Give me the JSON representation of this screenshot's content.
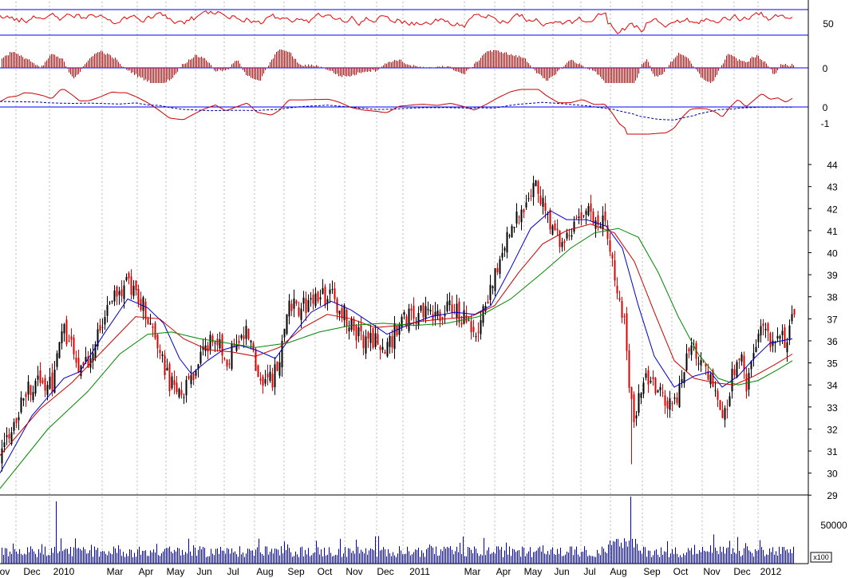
{
  "chart_data": {
    "type": "candlestick",
    "price_axis": {
      "ticks": [
        29,
        30,
        31,
        32,
        33,
        34,
        35,
        36,
        37,
        38,
        39,
        40,
        41,
        42,
        43,
        44
      ],
      "ylim": [
        28.5,
        44.8
      ]
    },
    "x_labels": [
      "ov",
      "Dec",
      "2010",
      "Mar",
      "Apr",
      "May",
      "Jun",
      "Jul",
      "Aug",
      "Sep",
      "Oct",
      "Nov",
      "Dec",
      "2011",
      "Mar",
      "Apr",
      "May",
      "Jun",
      "Jul",
      "Aug",
      "Sep",
      "Oct",
      "Nov",
      "Dec",
      "2012"
    ],
    "price_key_points": [
      [
        0,
        30.4
      ],
      [
        10,
        31.8
      ],
      [
        22,
        32.6
      ],
      [
        30,
        33.6
      ],
      [
        40,
        34.0
      ],
      [
        55,
        34.1
      ],
      [
        65,
        33.9
      ],
      [
        78,
        36.6
      ],
      [
        90,
        35.6
      ],
      [
        100,
        34.6
      ],
      [
        112,
        35.1
      ],
      [
        125,
        36.4
      ],
      [
        140,
        38.1
      ],
      [
        158,
        38.6
      ],
      [
        172,
        38.0
      ],
      [
        185,
        37.2
      ],
      [
        200,
        35.6
      ],
      [
        212,
        34.1
      ],
      [
        230,
        33.6
      ],
      [
        242,
        34.6
      ],
      [
        255,
        35.6
      ],
      [
        270,
        36.4
      ],
      [
        283,
        35.1
      ],
      [
        297,
        35.9
      ],
      [
        310,
        36.6
      ],
      [
        322,
        34.6
      ],
      [
        340,
        34.1
      ],
      [
        350,
        35.1
      ],
      [
        362,
        37.4
      ],
      [
        378,
        37.6
      ],
      [
        395,
        37.9
      ],
      [
        412,
        38.1
      ],
      [
        425,
        37.6
      ],
      [
        440,
        36.6
      ],
      [
        455,
        36.1
      ],
      [
        470,
        35.9
      ],
      [
        485,
        35.6
      ],
      [
        500,
        36.9
      ],
      [
        515,
        37.1
      ],
      [
        530,
        37.3
      ],
      [
        548,
        37.1
      ],
      [
        565,
        37.6
      ],
      [
        580,
        37.1
      ],
      [
        595,
        36.4
      ],
      [
        610,
        37.9
      ],
      [
        625,
        39.6
      ],
      [
        640,
        41.1
      ],
      [
        655,
        42.1
      ],
      [
        670,
        43.1
      ],
      [
        685,
        41.6
      ],
      [
        700,
        40.6
      ],
      [
        715,
        41.1
      ],
      [
        730,
        42.1
      ],
      [
        745,
        41.4
      ],
      [
        758,
        41.6
      ],
      [
        768,
        39.6
      ],
      [
        776,
        37.6
      ],
      [
        783,
        36.6
      ],
      [
        790,
        33.1
      ],
      [
        796,
        32.1
      ],
      [
        805,
        34.6
      ],
      [
        815,
        34.1
      ],
      [
        825,
        33.6
      ],
      [
        835,
        32.9
      ],
      [
        845,
        33.1
      ],
      [
        855,
        34.6
      ],
      [
        865,
        35.6
      ],
      [
        875,
        35.1
      ],
      [
        885,
        34.6
      ],
      [
        895,
        33.6
      ],
      [
        905,
        32.1
      ],
      [
        915,
        34.1
      ],
      [
        925,
        35.6
      ],
      [
        935,
        34.1
      ],
      [
        945,
        35.6
      ],
      [
        955,
        37.1
      ],
      [
        965,
        36.1
      ],
      [
        975,
        36.6
      ],
      [
        985,
        35.9
      ],
      [
        993,
        36.9
      ]
    ],
    "moving_averages": [
      {
        "color": "#0000cc",
        "points": [
          [
            0,
            30.0
          ],
          [
            40,
            32.6
          ],
          [
            80,
            34.3
          ],
          [
            100,
            34.6
          ],
          [
            130,
            36.3
          ],
          [
            160,
            37.9
          ],
          [
            185,
            37.5
          ],
          [
            205,
            36.8
          ],
          [
            225,
            35.2
          ],
          [
            240,
            34.5
          ],
          [
            260,
            35.1
          ],
          [
            280,
            35.6
          ],
          [
            300,
            35.8
          ],
          [
            320,
            35.6
          ],
          [
            345,
            35.2
          ],
          [
            365,
            36.2
          ],
          [
            390,
            37.3
          ],
          [
            415,
            37.8
          ],
          [
            440,
            37.4
          ],
          [
            465,
            36.8
          ],
          [
            485,
            36.3
          ],
          [
            510,
            36.7
          ],
          [
            540,
            37.1
          ],
          [
            570,
            37.3
          ],
          [
            595,
            37.2
          ],
          [
            615,
            37.6
          ],
          [
            640,
            39.3
          ],
          [
            665,
            41.1
          ],
          [
            690,
            41.9
          ],
          [
            710,
            41.5
          ],
          [
            735,
            41.5
          ],
          [
            760,
            41.2
          ],
          [
            780,
            40.2
          ],
          [
            800,
            37.6
          ],
          [
            820,
            35.3
          ],
          [
            845,
            33.9
          ],
          [
            870,
            34.4
          ],
          [
            890,
            34.6
          ],
          [
            905,
            33.9
          ],
          [
            925,
            34.4
          ],
          [
            945,
            35.2
          ],
          [
            965,
            35.9
          ],
          [
            993,
            36.1
          ]
        ]
      },
      {
        "color": "#cc0000",
        "points": [
          [
            0,
            30.8
          ],
          [
            50,
            32.9
          ],
          [
            90,
            34.1
          ],
          [
            130,
            35.6
          ],
          [
            170,
            37.1
          ],
          [
            200,
            37.0
          ],
          [
            230,
            36.1
          ],
          [
            260,
            35.6
          ],
          [
            290,
            35.5
          ],
          [
            320,
            35.3
          ],
          [
            350,
            35.7
          ],
          [
            380,
            36.6
          ],
          [
            410,
            37.2
          ],
          [
            440,
            37.0
          ],
          [
            470,
            36.6
          ],
          [
            500,
            36.7
          ],
          [
            530,
            36.9
          ],
          [
            560,
            37.0
          ],
          [
            590,
            37.1
          ],
          [
            620,
            37.6
          ],
          [
            650,
            39.1
          ],
          [
            680,
            40.4
          ],
          [
            710,
            41.0
          ],
          [
            740,
            41.3
          ],
          [
            770,
            40.9
          ],
          [
            795,
            39.6
          ],
          [
            820,
            37.3
          ],
          [
            845,
            35.1
          ],
          [
            870,
            34.3
          ],
          [
            895,
            34.1
          ],
          [
            920,
            34.0
          ],
          [
            945,
            34.4
          ],
          [
            970,
            34.9
          ],
          [
            993,
            35.4
          ]
        ]
      },
      {
        "color": "#008800",
        "points": [
          [
            0,
            29.3
          ],
          [
            60,
            32.0
          ],
          [
            110,
            33.7
          ],
          [
            150,
            35.4
          ],
          [
            185,
            36.3
          ],
          [
            215,
            36.4
          ],
          [
            250,
            36.1
          ],
          [
            285,
            35.9
          ],
          [
            320,
            35.7
          ],
          [
            360,
            35.9
          ],
          [
            400,
            36.4
          ],
          [
            440,
            36.7
          ],
          [
            480,
            36.8
          ],
          [
            520,
            36.7
          ],
          [
            560,
            36.8
          ],
          [
            600,
            37.1
          ],
          [
            640,
            37.9
          ],
          [
            680,
            39.1
          ],
          [
            715,
            40.2
          ],
          [
            745,
            40.9
          ],
          [
            775,
            41.1
          ],
          [
            800,
            40.7
          ],
          [
            825,
            39.1
          ],
          [
            850,
            37.1
          ],
          [
            875,
            35.4
          ],
          [
            900,
            34.3
          ],
          [
            925,
            34.0
          ],
          [
            950,
            34.2
          ],
          [
            975,
            34.7
          ],
          [
            993,
            35.1
          ]
        ]
      }
    ],
    "top_panel": {
      "ticks": [
        50
      ]
    },
    "macd_hist_panel": {
      "ticks": [
        0
      ]
    },
    "macd_line_panel": {
      "ticks": [
        0,
        -1
      ]
    },
    "volume_panel": {
      "ticks": [
        50000
      ],
      "multiplier_label": "x100"
    }
  }
}
